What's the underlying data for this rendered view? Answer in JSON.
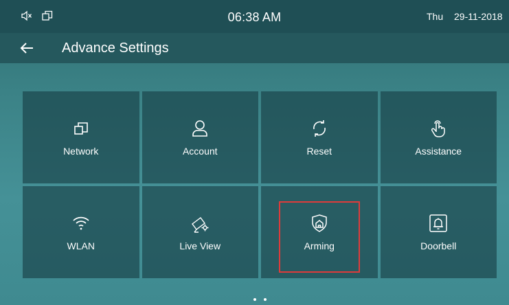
{
  "status": {
    "time": "06:38 AM",
    "day": "Thu",
    "date": "29-11-2018"
  },
  "header": {
    "title": "Advance Settings"
  },
  "tiles": [
    {
      "label": "Network",
      "icon": "network-icon"
    },
    {
      "label": "Account",
      "icon": "user-icon"
    },
    {
      "label": "Reset",
      "icon": "reset-icon"
    },
    {
      "label": "Assistance",
      "icon": "touch-hand-icon"
    },
    {
      "label": "WLAN",
      "icon": "wifi-icon"
    },
    {
      "label": "Live View",
      "icon": "camera-gear-icon"
    },
    {
      "label": "Arming",
      "icon": "shield-home-icon",
      "highlighted": true
    },
    {
      "label": "Doorbell",
      "icon": "bell-icon"
    }
  ],
  "pager": {
    "pages": 2,
    "current": 1
  },
  "colors": {
    "highlight_border": "#e03b3b"
  }
}
